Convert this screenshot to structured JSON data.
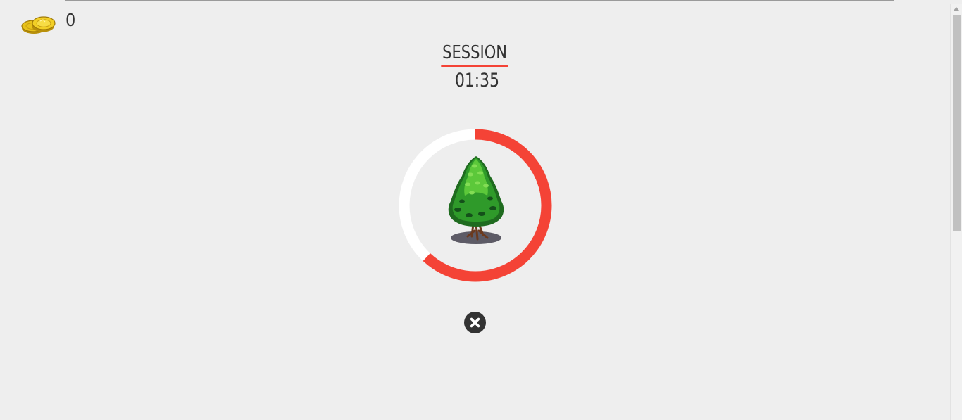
{
  "coins": {
    "count": "0",
    "icon": "coin-stack-icon"
  },
  "session": {
    "title": "SESSION",
    "time": "01:35"
  },
  "progress": {
    "fraction": 0.62,
    "color": "#f44336",
    "track_color": "#ffffff"
  },
  "tree": {
    "icon": "tree-icon"
  },
  "cancel": {
    "icon": "close-circle-icon"
  }
}
